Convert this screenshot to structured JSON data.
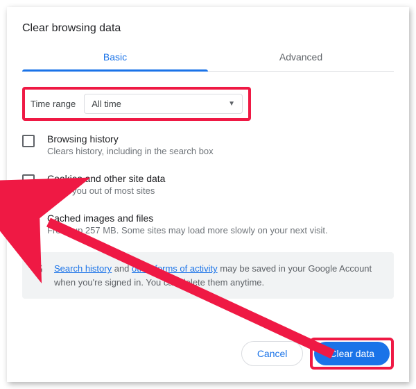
{
  "title": "Clear browsing data",
  "tabs": {
    "basic": "Basic",
    "advanced": "Advanced"
  },
  "timeRange": {
    "label": "Time range",
    "value": "All time"
  },
  "options": [
    {
      "checked": false,
      "primary": "Browsing history",
      "secondary": "Clears history, including in the search box"
    },
    {
      "checked": false,
      "primary": "Cookies and other site data",
      "secondary": "Signs you out of most sites"
    },
    {
      "checked": true,
      "primary": "Cached images and files",
      "secondary": "Frees up 257 MB. Some sites may load more slowly on your next visit."
    }
  ],
  "info": {
    "link1": "Search history",
    "mid1": " and ",
    "link2": "other forms of activity",
    "rest": " may be saved in your Google Account when you're signed in. You can delete them anytime."
  },
  "buttons": {
    "cancel": "Cancel",
    "clear": "Clear data"
  },
  "gIcon": "G"
}
